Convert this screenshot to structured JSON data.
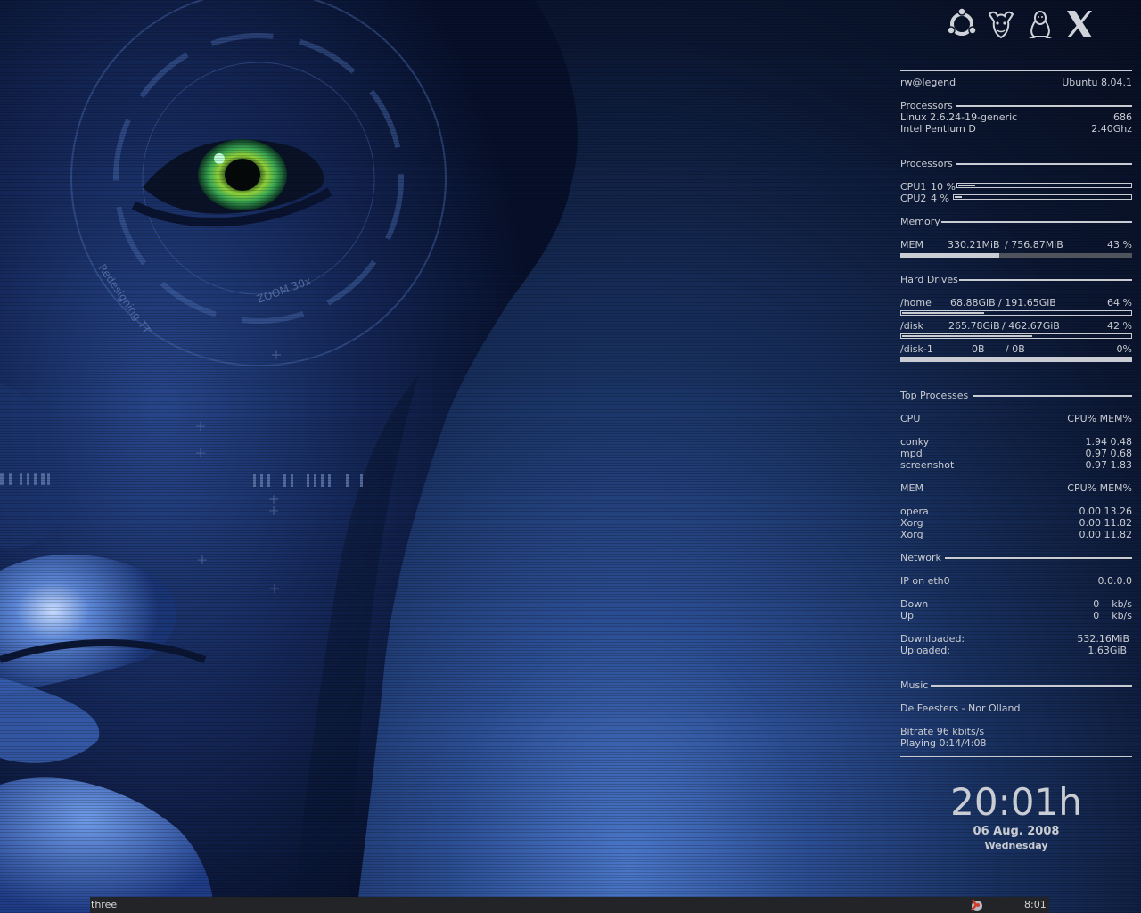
{
  "header": {
    "user_host": "rw@legend",
    "distro": "Ubuntu 8.04.1"
  },
  "top_icons": [
    {
      "icon": "ubuntu-logo-icon"
    },
    {
      "icon": "gnu-head-icon"
    },
    {
      "icon": "tux-penguin-icon"
    },
    {
      "icon": "x-window-system-icon"
    }
  ],
  "system": {
    "section": "Processors",
    "kernel": "Linux 2.6.24-19-generic",
    "arch": "i686",
    "cpu_model": "Intel Pentium D",
    "cpu_speed": "2.40Ghz"
  },
  "processors": {
    "section": "Processors",
    "cpus": [
      {
        "label": "CPU1",
        "value": "10 %",
        "fraction": 0.1
      },
      {
        "label": "CPU2",
        "value": "4 %",
        "fraction": 0.04
      }
    ]
  },
  "memory": {
    "section": "Memory",
    "label": "MEM",
    "used": "330.21MiB",
    "total": "/ 756.87MiB",
    "percent": "43 %",
    "fraction": 0.43
  },
  "drives": {
    "section": "Hard Drives",
    "items": [
      {
        "mount": "/home",
        "used": "68.88GiB",
        "total": "/ 191.65GiB",
        "percent": "64 %",
        "fraction": 0.36
      },
      {
        "mount": "/disk",
        "used": "265.78GiB",
        "total": "/ 462.67GiB",
        "percent": "42 %",
        "fraction": 0.57
      },
      {
        "mount": "/disk-1",
        "used": "0B",
        "total": "/ 0B",
        "percent": "0%",
        "fraction": 0.0
      }
    ]
  },
  "top_processes": {
    "section": "Top Processes",
    "cpu_header": "CPU",
    "mem_header": "MEM",
    "cols": "CPU% MEM%",
    "by_cpu": [
      {
        "name": "conky",
        "stats": "1.94  0.48"
      },
      {
        "name": "mpd",
        "stats": "0.97  0.68"
      },
      {
        "name": "screenshot",
        "stats": "0.97  1.83"
      }
    ],
    "by_mem": [
      {
        "name": "opera",
        "stats": "0.00 13.26"
      },
      {
        "name": "Xorg",
        "stats": "0.00 11.82"
      },
      {
        "name": "Xorg",
        "stats": "0.00 11.82"
      }
    ]
  },
  "network": {
    "section": "Network",
    "ip_label": "IP on eth0",
    "ip": "0.0.0.0",
    "down_label": "Down",
    "down": "0    kb/s",
    "up_label": "Up",
    "up": "0    kb/s",
    "downloaded_label": "Downloaded:",
    "downloaded": "532.16MiB",
    "uploaded_label": "Uploaded:",
    "uploaded": "1.63GiB"
  },
  "music": {
    "section": "Music",
    "track": "De Feesters - Nor Olland",
    "bitrate": "Bitrate 96 kbits/s",
    "playing": "Playing 0:14/4:08"
  },
  "clock": {
    "time": "20:01h",
    "date": "06 Aug. 2008",
    "day": "Wednesday"
  },
  "taskbar": {
    "workspace": "three",
    "tray_icon": "app-tray-icon",
    "time": "8:01"
  },
  "wallpaper": {
    "hud_text_1": "Redesigning TT",
    "hud_text_2": "ZOOM 30x",
    "colors": {
      "bg_dark": "#060c1c",
      "bg_blue": "#2b4d92",
      "eye_green": "#5fd85a",
      "text": "#c9ccd2"
    }
  }
}
